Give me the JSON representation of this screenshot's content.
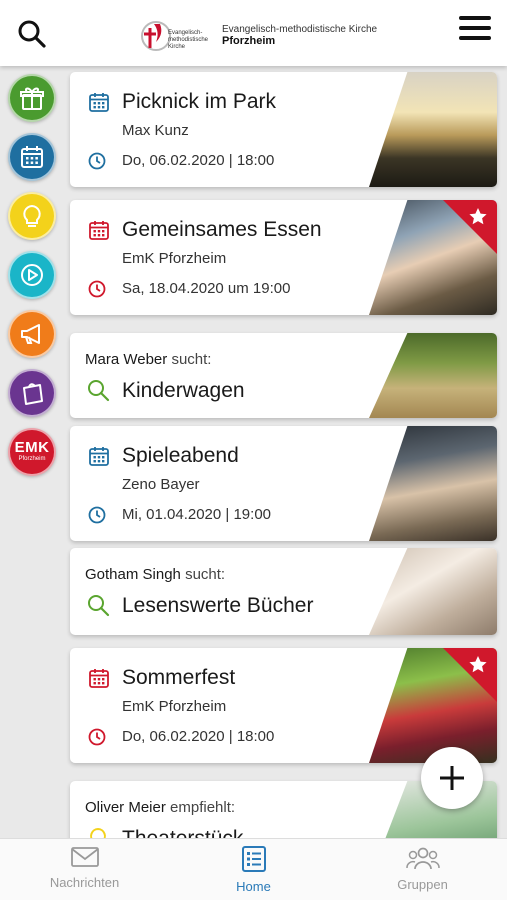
{
  "header": {
    "logo_line1": "Evangelisch-methodistische Kirche",
    "logo_line2": "Pforzheim",
    "logo_mark_text": "Evangelisch-methodistische Kirche"
  },
  "sidebar": {
    "items": [
      {
        "icon": "gift-icon",
        "color": "#4a9b2f"
      },
      {
        "icon": "calendar-icon",
        "color": "#1f6fa0"
      },
      {
        "icon": "lightbulb-icon",
        "color": "#f3d21b"
      },
      {
        "icon": "play-icon",
        "color": "#1ab5c8"
      },
      {
        "icon": "megaphone-icon",
        "color": "#f07c1a"
      },
      {
        "icon": "bag-icon",
        "color": "#6a3590"
      },
      {
        "icon": "emk-pforzheim-icon",
        "color": "#d0182c",
        "label": "EMK",
        "sublabel": "Pforzheim"
      }
    ]
  },
  "feed": {
    "cards": [
      {
        "kind": "event",
        "title": "Picknick im Park",
        "subtitle": "Max Kunz",
        "date": "Do, 06.02.2020 | 18:00",
        "accent": "#1f6fa0",
        "featured": false
      },
      {
        "kind": "event",
        "title": "Gemeinsames Essen",
        "subtitle": "EmK Pforzheim",
        "date": "Sa, 18.04.2020 um 19:00",
        "accent": "#d0182c",
        "featured": true
      },
      {
        "kind": "search",
        "who": "Mara Weber",
        "verb": "sucht:",
        "what": "Kinderwagen",
        "accent": "#5aa52f"
      },
      {
        "kind": "event",
        "title": "Spieleabend",
        "subtitle": "Zeno Bayer",
        "date": "Mi, 01.04.2020 | 19:00",
        "accent": "#1f6fa0",
        "featured": false
      },
      {
        "kind": "search",
        "who": "Gotham Singh",
        "verb": "sucht:",
        "what": "Lesenswerte Bücher",
        "accent": "#5aa52f"
      },
      {
        "kind": "event",
        "title": "Sommerfest",
        "subtitle": "EmK Pforzheim",
        "date": "Do, 06.02.2020 | 18:00",
        "accent": "#d0182c",
        "featured": true
      },
      {
        "kind": "recommend",
        "who": "Oliver Meier",
        "verb": "empfiehlt:",
        "what": "Theaterstück",
        "accent": "#f3d21b"
      }
    ]
  },
  "fab": {
    "icon": "plus-icon"
  },
  "bottom_nav": {
    "items": [
      {
        "label": "Nachrichten",
        "icon": "mail-icon",
        "active": false
      },
      {
        "label": "Home",
        "icon": "home-list-icon",
        "active": true
      },
      {
        "label": "Gruppen",
        "icon": "group-icon",
        "active": false
      }
    ],
    "active_color": "#2a7ab8",
    "inactive_color": "#999999"
  }
}
